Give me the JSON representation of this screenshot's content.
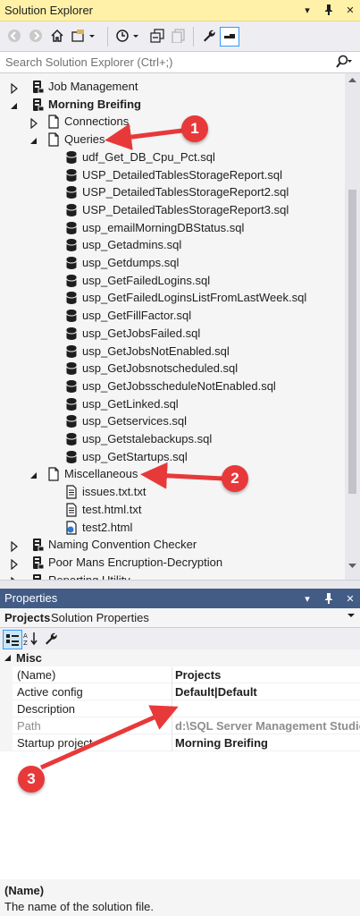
{
  "solution_explorer": {
    "title": "Solution Explorer",
    "search_placeholder": "Search Solution Explorer (Ctrl+;)",
    "tree": [
      {
        "label": "Job Management",
        "level": 0,
        "expanded": false,
        "bold": false,
        "icon": "project-icon"
      },
      {
        "label": "Morning Breifing",
        "level": 0,
        "expanded": true,
        "bold": true,
        "icon": "project-icon"
      },
      {
        "label": "Connections",
        "level": 1,
        "expanded": false,
        "bold": false,
        "icon": "folder-icon"
      },
      {
        "label": "Queries",
        "level": 1,
        "expanded": true,
        "bold": false,
        "icon": "folder-icon"
      },
      {
        "label": "udf_Get_DB_Cpu_Pct.sql",
        "level": 2,
        "icon": "database-icon"
      },
      {
        "label": "USP_DetailedTablesStorageReport.sql",
        "level": 2,
        "icon": "database-icon"
      },
      {
        "label": "USP_DetailedTablesStorageReport2.sql",
        "level": 2,
        "icon": "database-icon"
      },
      {
        "label": "USP_DetailedTablesStorageReport3.sql",
        "level": 2,
        "icon": "database-icon"
      },
      {
        "label": "usp_emailMorningDBStatus.sql",
        "level": 2,
        "icon": "database-icon"
      },
      {
        "label": "usp_Getadmins.sql",
        "level": 2,
        "icon": "database-icon"
      },
      {
        "label": "usp_Getdumps.sql",
        "level": 2,
        "icon": "database-icon"
      },
      {
        "label": "usp_GetFailedLogins.sql",
        "level": 2,
        "icon": "database-icon"
      },
      {
        "label": "usp_GetFailedLoginsListFromLastWeek.sql",
        "level": 2,
        "icon": "database-icon"
      },
      {
        "label": "usp_GetFillFactor.sql",
        "level": 2,
        "icon": "database-icon"
      },
      {
        "label": "usp_GetJobsFailed.sql",
        "level": 2,
        "icon": "database-icon"
      },
      {
        "label": "usp_GetJobsNotEnabled.sql",
        "level": 2,
        "icon": "database-icon"
      },
      {
        "label": "usp_GetJobsnotscheduled.sql",
        "level": 2,
        "icon": "database-icon"
      },
      {
        "label": "usp_GetJobsscheduleNotEnabled.sql",
        "level": 2,
        "icon": "database-icon"
      },
      {
        "label": "usp_GetLinked.sql",
        "level": 2,
        "icon": "database-icon"
      },
      {
        "label": "usp_Getservices.sql",
        "level": 2,
        "icon": "database-icon"
      },
      {
        "label": "usp_Getstalebackups.sql",
        "level": 2,
        "icon": "database-icon"
      },
      {
        "label": "usp_GetStartups.sql",
        "level": 2,
        "icon": "database-icon"
      },
      {
        "label": "Miscellaneous",
        "level": 1,
        "expanded": true,
        "bold": false,
        "icon": "folder-icon"
      },
      {
        "label": "issues.txt.txt",
        "level": 2,
        "icon": "text-file-icon"
      },
      {
        "label": "test.html.txt",
        "level": 2,
        "icon": "text-file-icon"
      },
      {
        "label": "test2.html",
        "level": 2,
        "icon": "html-file-icon"
      },
      {
        "label": "Naming Convention Checker",
        "level": 0,
        "expanded": false,
        "bold": false,
        "icon": "project-icon"
      },
      {
        "label": "Poor Mans Encruption-Decryption",
        "level": 0,
        "expanded": false,
        "bold": false,
        "icon": "project-icon"
      },
      {
        "label": "Reporting Utility",
        "level": 0,
        "expanded": false,
        "bold": false,
        "icon": "project-icon"
      }
    ]
  },
  "properties": {
    "title": "Properties",
    "object_name": "Projects",
    "object_type": "Solution Properties",
    "category": "Misc",
    "rows": [
      {
        "name": "(Name)",
        "value": "Projects",
        "disabled": false
      },
      {
        "name": "Active config",
        "value": "Default|Default",
        "disabled": false
      },
      {
        "name": "Description",
        "value": "",
        "disabled": false
      },
      {
        "name": "Path",
        "value": "d:\\SQL Server Management Studio",
        "disabled": true
      },
      {
        "name": "Startup project",
        "value": "Morning Breifing",
        "disabled": false
      }
    ],
    "description_name": "(Name)",
    "description_text": "The name of the solution file."
  },
  "callouts": [
    "1",
    "2",
    "3"
  ],
  "colors": {
    "se_title_bg": "#fff1a7",
    "pr_title_bg": "#425c86",
    "callout": "#e8393a"
  }
}
